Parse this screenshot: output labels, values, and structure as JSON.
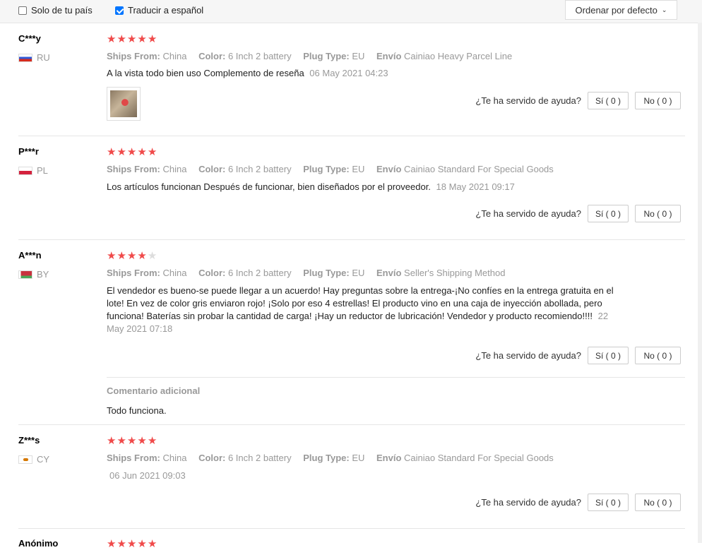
{
  "filters": {
    "only_country": {
      "label": "Solo de tu país",
      "checked": false
    },
    "translate": {
      "label": "Traducir a español",
      "checked": true
    },
    "sort_label": "Ordenar por defecto"
  },
  "helpful_question": "¿Te ha servido de ayuda?",
  "labels": {
    "ships_from": "Ships From:",
    "color": "Color:",
    "plug_type": "Plug Type:",
    "envio": "Envío",
    "additional_comment": "Comentario adicional"
  },
  "reviews": [
    {
      "user": "C***y",
      "country": "RU",
      "stars": 5,
      "ships_from": "China",
      "color": "6 Inch 2 battery",
      "plug_type": "EU",
      "envio": "Cainiao Heavy Parcel Line",
      "text": "A la vista todo bien uso Complemento de reseña",
      "date": "06 May 2021 04:23",
      "yes": "Sí ( 0 )",
      "no": "No ( 0 )"
    },
    {
      "user": "P***r",
      "country": "PL",
      "stars": 5,
      "ships_from": "China",
      "color": "6 Inch 2 battery",
      "plug_type": "EU",
      "envio": "Cainiao Standard For Special Goods",
      "text": "Los artículos funcionan Después de funcionar, bien diseñados por el proveedor.",
      "date": "18 May 2021 09:17",
      "yes": "Sí ( 0 )",
      "no": "No ( 0 )"
    },
    {
      "user": "A***n",
      "country": "BY",
      "stars": 4,
      "ships_from": "China",
      "color": "6 Inch 2 battery",
      "plug_type": "EU",
      "envio": "Seller's Shipping Method",
      "text": "El vendedor es bueno-se puede llegar a un acuerdo! Hay preguntas sobre la entrega-¡No confíes en la entrega gratuita en el lote! En vez de color gris enviaron rojo! ¡Solo por eso 4 estrellas! El producto vino en una caja de inyección abollada, pero funciona! Baterías sin probar la cantidad de carga! ¡Hay un reductor de lubricación! Vendedor y producto recomiendo!!!!",
      "date": "22 May 2021 07:18",
      "yes": "Sí ( 0 )",
      "no": "No ( 0 )",
      "additional": "Todo funciona."
    },
    {
      "user": "Z***s",
      "country": "CY",
      "stars": 5,
      "ships_from": "China",
      "color": "6 Inch 2 battery",
      "plug_type": "EU",
      "envio": "Cainiao Standard For Special Goods",
      "text": "",
      "date": "06 Jun 2021 09:03",
      "yes": "Sí ( 0 )",
      "no": "No ( 0 )"
    },
    {
      "user": "Anónimo",
      "stars": 5
    }
  ]
}
